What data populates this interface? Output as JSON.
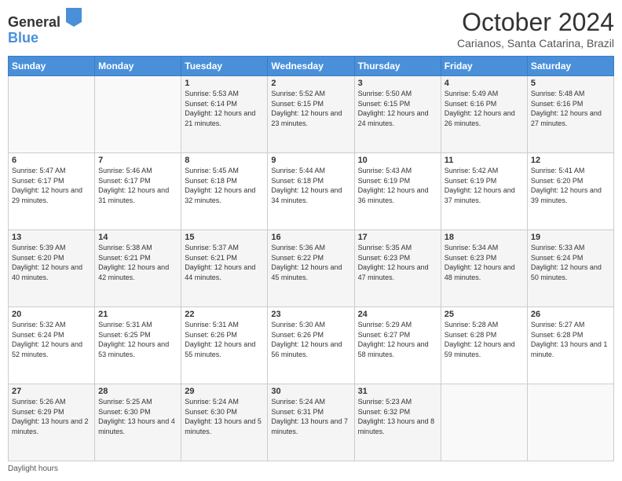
{
  "header": {
    "logo_general": "General",
    "logo_blue": "Blue",
    "title": "October 2024",
    "subtitle": "Carianos, Santa Catarina, Brazil"
  },
  "calendar": {
    "days_of_week": [
      "Sunday",
      "Monday",
      "Tuesday",
      "Wednesday",
      "Thursday",
      "Friday",
      "Saturday"
    ],
    "weeks": [
      [
        {
          "day": "",
          "info": ""
        },
        {
          "day": "",
          "info": ""
        },
        {
          "day": "1",
          "info": "Sunrise: 5:53 AM\nSunset: 6:14 PM\nDaylight: 12 hours and 21 minutes."
        },
        {
          "day": "2",
          "info": "Sunrise: 5:52 AM\nSunset: 6:15 PM\nDaylight: 12 hours and 23 minutes."
        },
        {
          "day": "3",
          "info": "Sunrise: 5:50 AM\nSunset: 6:15 PM\nDaylight: 12 hours and 24 minutes."
        },
        {
          "day": "4",
          "info": "Sunrise: 5:49 AM\nSunset: 6:16 PM\nDaylight: 12 hours and 26 minutes."
        },
        {
          "day": "5",
          "info": "Sunrise: 5:48 AM\nSunset: 6:16 PM\nDaylight: 12 hours and 27 minutes."
        }
      ],
      [
        {
          "day": "6",
          "info": "Sunrise: 5:47 AM\nSunset: 6:17 PM\nDaylight: 12 hours and 29 minutes."
        },
        {
          "day": "7",
          "info": "Sunrise: 5:46 AM\nSunset: 6:17 PM\nDaylight: 12 hours and 31 minutes."
        },
        {
          "day": "8",
          "info": "Sunrise: 5:45 AM\nSunset: 6:18 PM\nDaylight: 12 hours and 32 minutes."
        },
        {
          "day": "9",
          "info": "Sunrise: 5:44 AM\nSunset: 6:18 PM\nDaylight: 12 hours and 34 minutes."
        },
        {
          "day": "10",
          "info": "Sunrise: 5:43 AM\nSunset: 6:19 PM\nDaylight: 12 hours and 36 minutes."
        },
        {
          "day": "11",
          "info": "Sunrise: 5:42 AM\nSunset: 6:19 PM\nDaylight: 12 hours and 37 minutes."
        },
        {
          "day": "12",
          "info": "Sunrise: 5:41 AM\nSunset: 6:20 PM\nDaylight: 12 hours and 39 minutes."
        }
      ],
      [
        {
          "day": "13",
          "info": "Sunrise: 5:39 AM\nSunset: 6:20 PM\nDaylight: 12 hours and 40 minutes."
        },
        {
          "day": "14",
          "info": "Sunrise: 5:38 AM\nSunset: 6:21 PM\nDaylight: 12 hours and 42 minutes."
        },
        {
          "day": "15",
          "info": "Sunrise: 5:37 AM\nSunset: 6:21 PM\nDaylight: 12 hours and 44 minutes."
        },
        {
          "day": "16",
          "info": "Sunrise: 5:36 AM\nSunset: 6:22 PM\nDaylight: 12 hours and 45 minutes."
        },
        {
          "day": "17",
          "info": "Sunrise: 5:35 AM\nSunset: 6:23 PM\nDaylight: 12 hours and 47 minutes."
        },
        {
          "day": "18",
          "info": "Sunrise: 5:34 AM\nSunset: 6:23 PM\nDaylight: 12 hours and 48 minutes."
        },
        {
          "day": "19",
          "info": "Sunrise: 5:33 AM\nSunset: 6:24 PM\nDaylight: 12 hours and 50 minutes."
        }
      ],
      [
        {
          "day": "20",
          "info": "Sunrise: 5:32 AM\nSunset: 6:24 PM\nDaylight: 12 hours and 52 minutes."
        },
        {
          "day": "21",
          "info": "Sunrise: 5:31 AM\nSunset: 6:25 PM\nDaylight: 12 hours and 53 minutes."
        },
        {
          "day": "22",
          "info": "Sunrise: 5:31 AM\nSunset: 6:26 PM\nDaylight: 12 hours and 55 minutes."
        },
        {
          "day": "23",
          "info": "Sunrise: 5:30 AM\nSunset: 6:26 PM\nDaylight: 12 hours and 56 minutes."
        },
        {
          "day": "24",
          "info": "Sunrise: 5:29 AM\nSunset: 6:27 PM\nDaylight: 12 hours and 58 minutes."
        },
        {
          "day": "25",
          "info": "Sunrise: 5:28 AM\nSunset: 6:28 PM\nDaylight: 12 hours and 59 minutes."
        },
        {
          "day": "26",
          "info": "Sunrise: 5:27 AM\nSunset: 6:28 PM\nDaylight: 13 hours and 1 minute."
        }
      ],
      [
        {
          "day": "27",
          "info": "Sunrise: 5:26 AM\nSunset: 6:29 PM\nDaylight: 13 hours and 2 minutes."
        },
        {
          "day": "28",
          "info": "Sunrise: 5:25 AM\nSunset: 6:30 PM\nDaylight: 13 hours and 4 minutes."
        },
        {
          "day": "29",
          "info": "Sunrise: 5:24 AM\nSunset: 6:30 PM\nDaylight: 13 hours and 5 minutes."
        },
        {
          "day": "30",
          "info": "Sunrise: 5:24 AM\nSunset: 6:31 PM\nDaylight: 13 hours and 7 minutes."
        },
        {
          "day": "31",
          "info": "Sunrise: 5:23 AM\nSunset: 6:32 PM\nDaylight: 13 hours and 8 minutes."
        },
        {
          "day": "",
          "info": ""
        },
        {
          "day": "",
          "info": ""
        }
      ]
    ]
  },
  "footer": {
    "note": "Daylight hours"
  }
}
